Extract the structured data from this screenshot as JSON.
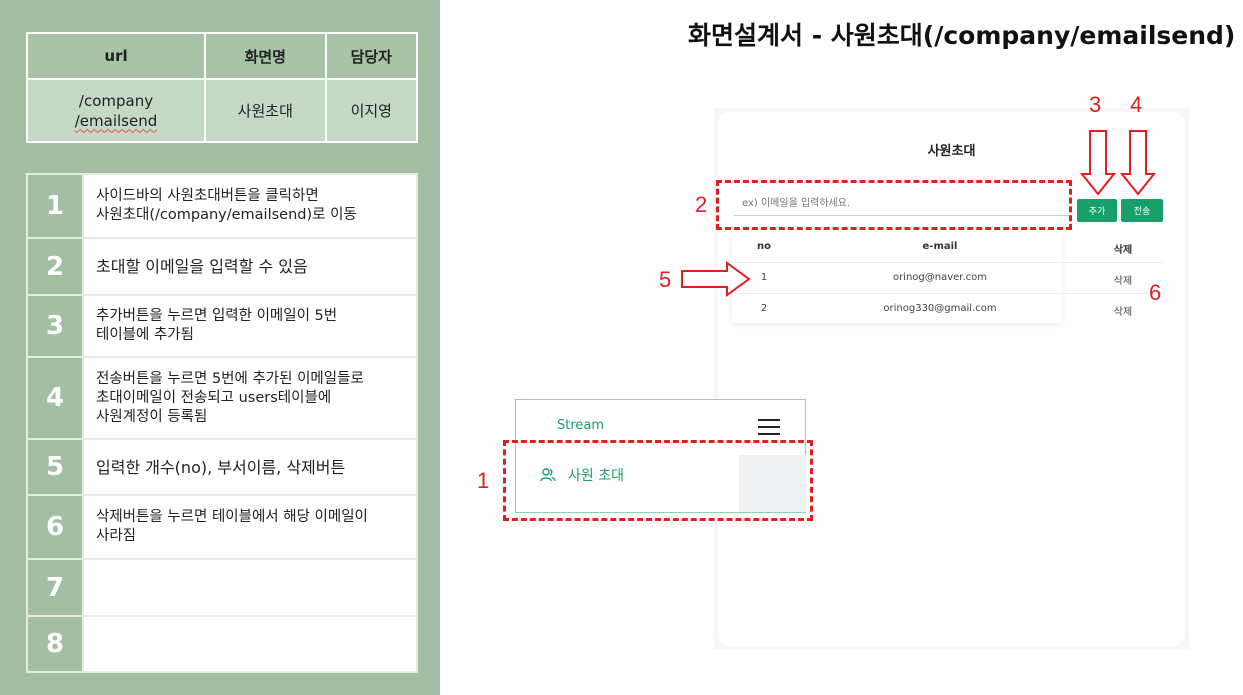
{
  "header": {
    "title": "화면설계서 - 사원초대(/company/emailsend)"
  },
  "meta": {
    "headers": [
      "url",
      "화면명",
      "담당자"
    ],
    "url_line1": "/company",
    "url_line2": "/emailsend",
    "screen_name": "사원초대",
    "owner": "이지영"
  },
  "descriptions": [
    {
      "num": "1",
      "text": "사이드바의 사원초대버튼을 클릭하면\n사원초대(/company/emailsend)로 이동"
    },
    {
      "num": "2",
      "text": "초대할 이메일을 입력할 수 있음"
    },
    {
      "num": "3",
      "text": "추가버튼을 누르면 입력한 이메일이 5번\n테이블에 추가됨"
    },
    {
      "num": "4",
      "text": "전송버튼을 누르면 5번에 추가된 이메일들로\n초대이메일이 전송되고 users테이블에\n사원계정이 등록됨"
    },
    {
      "num": "5",
      "text": "입력한 개수(no), 부서이름, 삭제버튼"
    },
    {
      "num": "6",
      "text": "삭제버튼을 누르면 테이블에서 해당 이메일이\n사라짐"
    },
    {
      "num": "7",
      "text": ""
    },
    {
      "num": "8",
      "text": ""
    }
  ],
  "mockup": {
    "title": "사원초대",
    "input_placeholder": "ex) 이메일을 입력하세요.",
    "add_button": "추가",
    "send_button": "전송",
    "columns": [
      "no",
      "e-mail",
      "삭제"
    ],
    "rows": [
      {
        "no": "1",
        "email": "orinog@naver.com",
        "delete": "삭제"
      },
      {
        "no": "2",
        "email": "orinog330@gmail.com",
        "delete": "삭제"
      }
    ]
  },
  "sidebar": {
    "brand": "Stream",
    "menu_item": "사원 초대"
  },
  "markers": [
    "1",
    "2",
    "3",
    "4",
    "5",
    "6"
  ],
  "colors": {
    "panel": "#a3bfa3",
    "accent": "#18a06a",
    "annotation": "#e02020"
  }
}
